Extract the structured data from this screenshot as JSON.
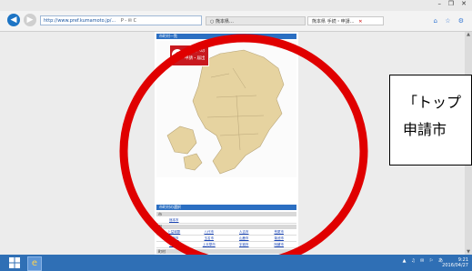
{
  "window": {
    "controls": {
      "minimize": "–",
      "restore": "❐",
      "close": "✕"
    }
  },
  "browser": {
    "address": "http://www.pref.kumamoto.jp/...",
    "address_suffix": "P - ✉ C",
    "tabs": [
      {
        "label": "○ 熊本県…",
        "close": ""
      },
      {
        "label": "熊本県 手続・申請…",
        "close": "✕"
      }
    ],
    "toolbar_icons": "⌂ ☆ ⚙"
  },
  "page": {
    "header": "市町村一覧",
    "banner_lines": [
      "熊本県への",
      "申請・届出"
    ],
    "region_table_title": "市町村の選択",
    "sections": [
      {
        "head": "市",
        "rows": [
          [
            "熊本市",
            "",
            "",
            ""
          ]
        ]
      },
      {
        "head": "郡",
        "rows": [
          [
            "上益城郡",
            "八代市",
            "人吉市",
            "荒尾市"
          ],
          [
            "水俣市",
            "玉名市",
            "山鹿市",
            "菊池市"
          ],
          [
            "宇土市",
            "上天草市",
            "宇城市",
            "阿蘇市"
          ]
        ]
      },
      {
        "head": "町村",
        "rows": [
          [
            "美里町",
            "玉東町",
            "和水町",
            "南関町"
          ],
          [
            "長洲町",
            "大津町",
            "菊陽町",
            "南小国町"
          ],
          [
            "小国町",
            "産山村",
            "高森町",
            "西原村"
          ]
        ]
      }
    ]
  },
  "callout": {
    "lines": [
      "「トップ",
      "申請市"
    ]
  },
  "taskbar": {
    "tray": "▲ ♫ ✉ ⚐ あ",
    "time": "9:21",
    "date": "2016/04/27"
  },
  "colors": {
    "accent": "#2b6fc2",
    "annotation": "#e00000",
    "map_fill": "#e6d3a0",
    "banner": "#c8191f"
  }
}
